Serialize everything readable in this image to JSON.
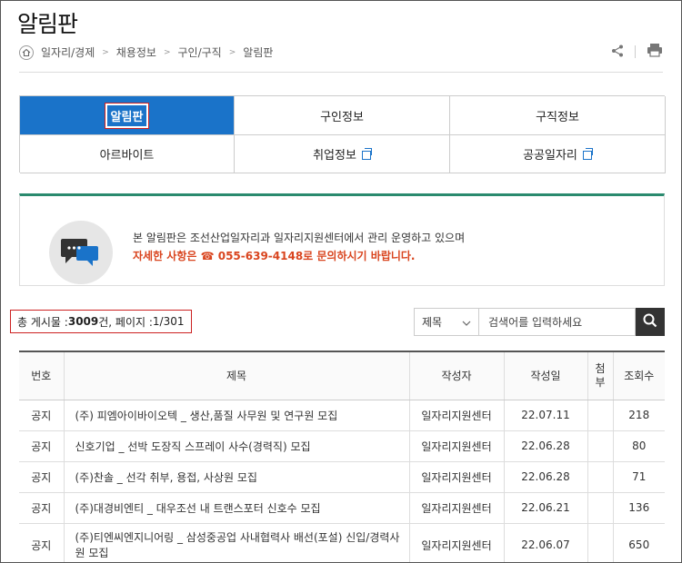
{
  "page": {
    "title": "알림판"
  },
  "breadcrumb": [
    "일자리/경제",
    "채용정보",
    "구인/구직",
    "알림판"
  ],
  "tabs": [
    {
      "label": "알림판",
      "active": true,
      "external": false
    },
    {
      "label": "구인정보",
      "active": false,
      "external": false
    },
    {
      "label": "구직정보",
      "active": false,
      "external": false
    },
    {
      "label": "아르바이트",
      "active": false,
      "external": false
    },
    {
      "label": "취업정보",
      "active": false,
      "external": true
    },
    {
      "label": "공공일자리",
      "active": false,
      "external": true
    }
  ],
  "notice": {
    "line1": "본 알림판은 조선산업일자리과 일자리지원센터에서 관리 운영하고 있으며",
    "line2": "자세한 사항은 ☎ 055-639-4148로 문의하시기 바랍니다."
  },
  "count": {
    "prefix": "총 게시물 : ",
    "total": "3009",
    "total_suffix": "건",
    "sep": ", 페이지 : ",
    "page": "1/301"
  },
  "search": {
    "field": "제목",
    "placeholder": "검색어를 입력하세요"
  },
  "table": {
    "headers": [
      "번호",
      "제목",
      "작성자",
      "작성일",
      "첨부",
      "조회수"
    ],
    "rows": [
      {
        "no": "공지",
        "title": "(주) 피엠아이바이오텍 _ 생산,품질 사무원 및 연구원 모집",
        "author": "일자리지원센터",
        "date": "22.07.11",
        "attach": "",
        "views": "218"
      },
      {
        "no": "공지",
        "title": "신호기업 _ 선박 도장직 스프레이 사수(경력직) 모집",
        "author": "일자리지원센터",
        "date": "22.06.28",
        "attach": "",
        "views": "80"
      },
      {
        "no": "공지",
        "title": "(주)찬솔 _ 선각 취부, 용접, 사상원 모집",
        "author": "일자리지원센터",
        "date": "22.06.28",
        "attach": "",
        "views": "71"
      },
      {
        "no": "공지",
        "title": "(주)대경비엔티 _ 대우조선 내 트랜스포터 신호수 모집",
        "author": "일자리지원센터",
        "date": "22.06.21",
        "attach": "",
        "views": "136"
      },
      {
        "no": "공지",
        "title": "(주)티엔씨엔지니어링 _ 삼성중공업 사내협력사 배선(포설) 신입/경력사원 모집",
        "author": "일자리지원센터",
        "date": "22.06.07",
        "attach": "",
        "views": "650"
      }
    ]
  },
  "colors": {
    "accent": "#1a73c9",
    "notice_bar": "#2a8a6e",
    "highlight": "#d9451f",
    "marker": "#cc2222"
  },
  "icons": {
    "home": "home-icon",
    "share": "share-icon",
    "print": "print-icon",
    "chat": "chat-bubble-icon",
    "search": "search-icon",
    "external": "external-link-icon",
    "dropdown": "chevron-down-icon"
  }
}
